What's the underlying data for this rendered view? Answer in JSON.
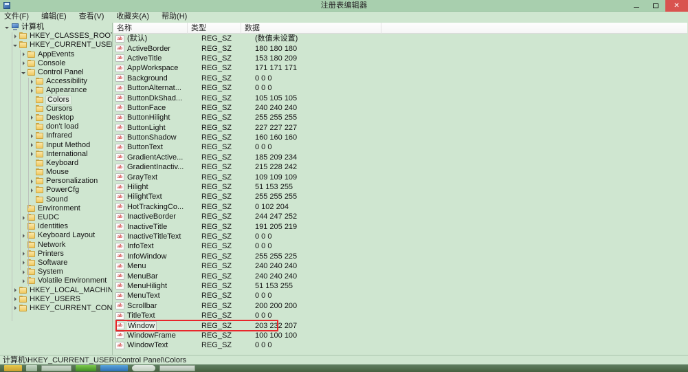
{
  "window": {
    "title": "注册表编辑器",
    "icon": "registry-editor-icon",
    "minimize_label": "",
    "maximize_label": "",
    "close_label": "✕"
  },
  "menu": {
    "items": [
      {
        "label": "文件(F)",
        "accel": "F"
      },
      {
        "label": "编辑(E)",
        "accel": "E"
      },
      {
        "label": "查看(V)",
        "accel": "V"
      },
      {
        "label": "收藏夹(A)",
        "accel": "A"
      },
      {
        "label": "帮助(H)",
        "accel": "H"
      }
    ]
  },
  "tree": {
    "items": [
      {
        "label": "计算机",
        "indent": 0,
        "twisty": "open",
        "icon": "computer-icon"
      },
      {
        "label": "HKEY_CLASSES_ROOT",
        "indent": 1,
        "twisty": "closed",
        "icon": "folder-icon"
      },
      {
        "label": "HKEY_CURRENT_USER",
        "indent": 1,
        "twisty": "open",
        "icon": "folder-icon"
      },
      {
        "label": "AppEvents",
        "indent": 2,
        "twisty": "closed",
        "icon": "folder-icon"
      },
      {
        "label": "Console",
        "indent": 2,
        "twisty": "closed",
        "icon": "folder-icon"
      },
      {
        "label": "Control Panel",
        "indent": 2,
        "twisty": "open",
        "icon": "folder-icon"
      },
      {
        "label": "Accessibility",
        "indent": 3,
        "twisty": "closed",
        "icon": "folder-icon"
      },
      {
        "label": "Appearance",
        "indent": 3,
        "twisty": "closed",
        "icon": "folder-icon"
      },
      {
        "label": "Colors",
        "indent": 3,
        "twisty": "none",
        "icon": "folder-icon",
        "selected": true
      },
      {
        "label": "Cursors",
        "indent": 3,
        "twisty": "none",
        "icon": "folder-icon"
      },
      {
        "label": "Desktop",
        "indent": 3,
        "twisty": "closed",
        "icon": "folder-icon"
      },
      {
        "label": "don't load",
        "indent": 3,
        "twisty": "none",
        "icon": "folder-icon"
      },
      {
        "label": "Infrared",
        "indent": 3,
        "twisty": "closed",
        "icon": "folder-icon"
      },
      {
        "label": "Input Method",
        "indent": 3,
        "twisty": "closed",
        "icon": "folder-icon"
      },
      {
        "label": "International",
        "indent": 3,
        "twisty": "closed",
        "icon": "folder-icon"
      },
      {
        "label": "Keyboard",
        "indent": 3,
        "twisty": "none",
        "icon": "folder-icon"
      },
      {
        "label": "Mouse",
        "indent": 3,
        "twisty": "none",
        "icon": "folder-icon"
      },
      {
        "label": "Personalization",
        "indent": 3,
        "twisty": "closed",
        "icon": "folder-icon"
      },
      {
        "label": "PowerCfg",
        "indent": 3,
        "twisty": "closed",
        "icon": "folder-icon"
      },
      {
        "label": "Sound",
        "indent": 3,
        "twisty": "none",
        "icon": "folder-icon"
      },
      {
        "label": "Environment",
        "indent": 2,
        "twisty": "none",
        "icon": "folder-icon"
      },
      {
        "label": "EUDC",
        "indent": 2,
        "twisty": "closed",
        "icon": "folder-icon"
      },
      {
        "label": "Identities",
        "indent": 2,
        "twisty": "none",
        "icon": "folder-icon"
      },
      {
        "label": "Keyboard Layout",
        "indent": 2,
        "twisty": "closed",
        "icon": "folder-icon"
      },
      {
        "label": "Network",
        "indent": 2,
        "twisty": "none",
        "icon": "folder-icon"
      },
      {
        "label": "Printers",
        "indent": 2,
        "twisty": "closed",
        "icon": "folder-icon"
      },
      {
        "label": "Software",
        "indent": 2,
        "twisty": "closed",
        "icon": "folder-icon"
      },
      {
        "label": "System",
        "indent": 2,
        "twisty": "closed",
        "icon": "folder-icon"
      },
      {
        "label": "Volatile Environment",
        "indent": 2,
        "twisty": "closed",
        "icon": "folder-icon"
      },
      {
        "label": "HKEY_LOCAL_MACHINE",
        "indent": 1,
        "twisty": "closed",
        "icon": "folder-icon"
      },
      {
        "label": "HKEY_USERS",
        "indent": 1,
        "twisty": "closed",
        "icon": "folder-icon"
      },
      {
        "label": "HKEY_CURRENT_CONFIG",
        "indent": 1,
        "twisty": "closed",
        "icon": "folder-icon"
      }
    ]
  },
  "list": {
    "columns": [
      "名称",
      "类型",
      "数据"
    ],
    "rows": [
      {
        "name": "(默认)",
        "type": "REG_SZ",
        "data": "(数值未设置)"
      },
      {
        "name": "ActiveBorder",
        "type": "REG_SZ",
        "data": "180 180 180"
      },
      {
        "name": "ActiveTitle",
        "type": "REG_SZ",
        "data": "153 180 209"
      },
      {
        "name": "AppWorkspace",
        "type": "REG_SZ",
        "data": "171 171 171"
      },
      {
        "name": "Background",
        "type": "REG_SZ",
        "data": "0 0 0"
      },
      {
        "name": "ButtonAlternat...",
        "type": "REG_SZ",
        "data": "0 0 0"
      },
      {
        "name": "ButtonDkShad...",
        "type": "REG_SZ",
        "data": "105 105 105"
      },
      {
        "name": "ButtonFace",
        "type": "REG_SZ",
        "data": "240 240 240"
      },
      {
        "name": "ButtonHilight",
        "type": "REG_SZ",
        "data": "255 255 255"
      },
      {
        "name": "ButtonLight",
        "type": "REG_SZ",
        "data": "227 227 227"
      },
      {
        "name": "ButtonShadow",
        "type": "REG_SZ",
        "data": "160 160 160"
      },
      {
        "name": "ButtonText",
        "type": "REG_SZ",
        "data": "0 0 0"
      },
      {
        "name": "GradientActive...",
        "type": "REG_SZ",
        "data": "185 209 234"
      },
      {
        "name": "GradientInactiv...",
        "type": "REG_SZ",
        "data": "215 228 242"
      },
      {
        "name": "GrayText",
        "type": "REG_SZ",
        "data": "109 109 109"
      },
      {
        "name": "Hilight",
        "type": "REG_SZ",
        "data": "51 153 255"
      },
      {
        "name": "HilightText",
        "type": "REG_SZ",
        "data": "255 255 255"
      },
      {
        "name": "HotTrackingCo...",
        "type": "REG_SZ",
        "data": "0 102 204"
      },
      {
        "name": "InactiveBorder",
        "type": "REG_SZ",
        "data": "244 247 252"
      },
      {
        "name": "InactiveTitle",
        "type": "REG_SZ",
        "data": "191 205 219"
      },
      {
        "name": "InactiveTitleText",
        "type": "REG_SZ",
        "data": "0 0 0"
      },
      {
        "name": "InfoText",
        "type": "REG_SZ",
        "data": "0 0 0"
      },
      {
        "name": "InfoWindow",
        "type": "REG_SZ",
        "data": "255 255 225"
      },
      {
        "name": "Menu",
        "type": "REG_SZ",
        "data": "240 240 240"
      },
      {
        "name": "MenuBar",
        "type": "REG_SZ",
        "data": "240 240 240"
      },
      {
        "name": "MenuHilight",
        "type": "REG_SZ",
        "data": "51 153 255"
      },
      {
        "name": "MenuText",
        "type": "REG_SZ",
        "data": "0 0 0"
      },
      {
        "name": "Scrollbar",
        "type": "REG_SZ",
        "data": "200 200 200"
      },
      {
        "name": "TitleText",
        "type": "REG_SZ",
        "data": "0 0 0"
      },
      {
        "name": "Window",
        "type": "REG_SZ",
        "data": "203 232 207",
        "highlighted": true,
        "boxed": true
      },
      {
        "name": "WindowFrame",
        "type": "REG_SZ",
        "data": "100 100 100"
      },
      {
        "name": "WindowText",
        "type": "REG_SZ",
        "data": "0 0 0"
      }
    ]
  },
  "status": {
    "path": "计算机\\HKEY_CURRENT_USER\\Control Panel\\Colors"
  },
  "colors": {
    "window_background": "#cfe6d0",
    "titlebar": "#a8cfae",
    "close_button": "#d9534f",
    "highlight_box": "#e8262a",
    "string_icon_text": "#cc2b2b"
  }
}
